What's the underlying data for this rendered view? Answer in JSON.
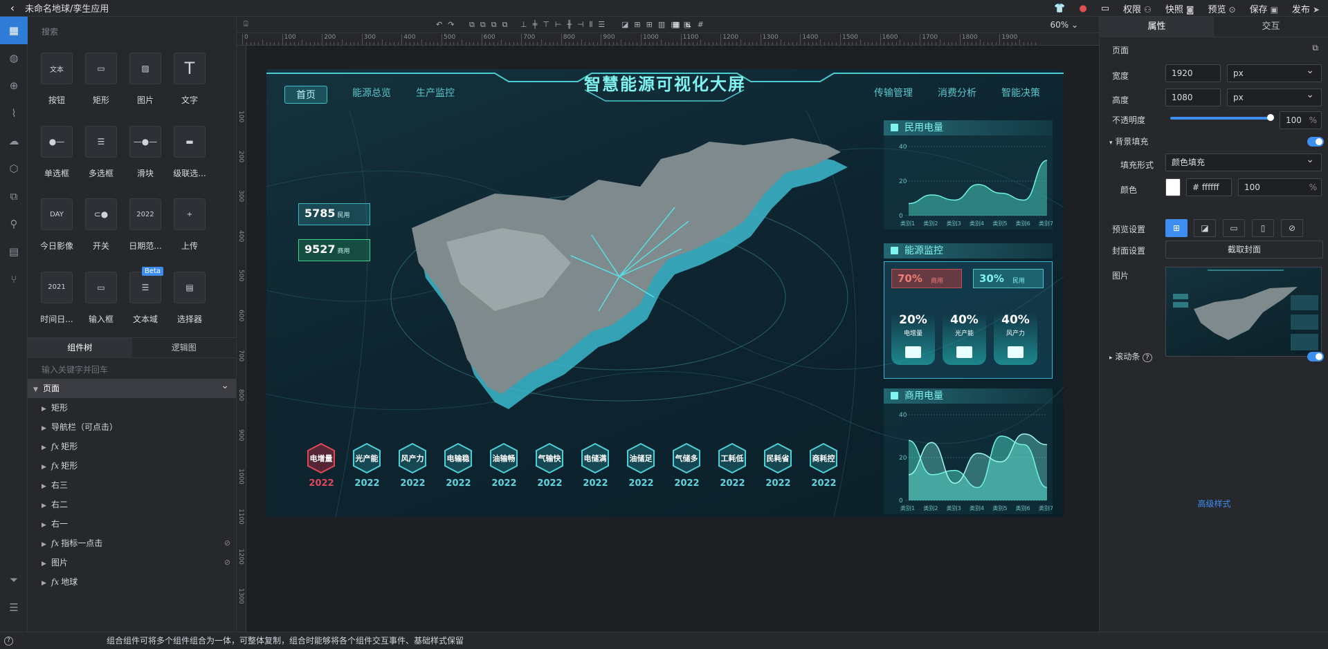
{
  "topbar": {
    "title": "未命名地球/孪生应用",
    "actions": [
      {
        "name": "shirt-icon",
        "label": ""
      },
      {
        "name": "record-icon",
        "label": ""
      },
      {
        "name": "screen-icon",
        "label": ""
      },
      {
        "name": "permission",
        "label": "权限",
        "icon": "users-icon"
      },
      {
        "name": "snapshot",
        "label": "快照",
        "icon": "camera-icon"
      },
      {
        "name": "preview",
        "label": "预览",
        "icon": "play-icon"
      },
      {
        "name": "save",
        "label": "保存",
        "icon": "save-icon"
      },
      {
        "name": "publish",
        "label": "发布",
        "icon": "send-icon"
      }
    ]
  },
  "left_panel": {
    "search_placeholder": "搜索",
    "components": [
      {
        "name": "button",
        "label": "按钮",
        "icon_text": "文本"
      },
      {
        "name": "rect",
        "label": "矩形",
        "icon_text": ""
      },
      {
        "name": "image",
        "label": "图片",
        "icon_text": ""
      },
      {
        "name": "text",
        "label": "文字",
        "icon_text": "T"
      },
      {
        "name": "radio",
        "label": "单选框",
        "icon_text": ""
      },
      {
        "name": "checkbox",
        "label": "多选框",
        "icon_text": ""
      },
      {
        "name": "slider",
        "label": "滑块",
        "icon_text": ""
      },
      {
        "name": "cascader",
        "label": "级联选...",
        "icon_text": ""
      },
      {
        "name": "today-image",
        "label": "今日影像",
        "icon_text": "DAY"
      },
      {
        "name": "switch",
        "label": "开关",
        "icon_text": ""
      },
      {
        "name": "date-range",
        "label": "日期范...",
        "icon_text": "2022"
      },
      {
        "name": "upload",
        "label": "上传",
        "icon_text": "+"
      },
      {
        "name": "datetime",
        "label": "时间日...",
        "icon_text": "2021"
      },
      {
        "name": "input",
        "label": "输入框",
        "icon_text": ""
      },
      {
        "name": "textarea",
        "label": "文本域",
        "icon_text": "",
        "beta": "Beta"
      },
      {
        "name": "selector",
        "label": "选择器",
        "icon_text": ""
      }
    ],
    "tabs": [
      "组件树",
      "逻辑图"
    ],
    "tree_search_placeholder": "输入关键字并回车",
    "tree": [
      {
        "label": "页面",
        "fx": false,
        "root": true
      },
      {
        "label": "矩形",
        "fx": false
      },
      {
        "label": "导航栏（可点击）",
        "fx": false
      },
      {
        "label": "矩形",
        "fx": true
      },
      {
        "label": "矩形",
        "fx": true
      },
      {
        "label": "右三",
        "fx": false
      },
      {
        "label": "右二",
        "fx": false
      },
      {
        "label": "右一",
        "fx": false
      },
      {
        "label": "指标一点击",
        "fx": true,
        "hidden": true
      },
      {
        "label": "图片",
        "fx": false,
        "hidden": true
      },
      {
        "label": "地球",
        "fx": true
      }
    ],
    "beta_badge": "Beta"
  },
  "canvas": {
    "zoom": "60%",
    "ruler_ticks": [
      "0",
      "100",
      "200",
      "300",
      "400",
      "500",
      "600",
      "700",
      "800",
      "900",
      "1000",
      "1100",
      "1200",
      "1300",
      "1400",
      "1500",
      "1600",
      "1700",
      "1800",
      "1900"
    ],
    "vruler_ticks": [
      "100",
      "200",
      "300",
      "400",
      "500",
      "600",
      "700",
      "800",
      "900",
      "1000",
      "1100",
      "1200",
      "1300"
    ]
  },
  "board": {
    "title": "智慧能源可视化大屏",
    "nav_left": [
      "首页",
      "能源总览",
      "生产监控"
    ],
    "nav_right": [
      "传输管理",
      "消费分析",
      "智能决策"
    ],
    "stats": [
      {
        "value": "5785",
        "unit": "民用"
      },
      {
        "value": "9527",
        "unit": "商用"
      }
    ],
    "hexes": [
      {
        "label": "电增量",
        "year": "2022",
        "red": true
      },
      {
        "label": "光产能",
        "year": "2022"
      },
      {
        "label": "风产力",
        "year": "2022"
      },
      {
        "label": "电输稳",
        "year": "2022"
      },
      {
        "label": "油输畅",
        "year": "2022"
      },
      {
        "label": "气输快",
        "year": "2022"
      },
      {
        "label": "电储满",
        "year": "2022"
      },
      {
        "label": "油储足",
        "year": "2022"
      },
      {
        "label": "气储多",
        "year": "2022"
      },
      {
        "label": "工耗低",
        "year": "2022"
      },
      {
        "label": "民耗省",
        "year": "2022"
      },
      {
        "label": "商耗控",
        "year": "2022"
      }
    ],
    "panel1_title": "民用电量",
    "panel2_title": "能源监控",
    "panel3_title": "商用电量",
    "monitor": {
      "badges": [
        {
          "value": "70%",
          "unit": "商用"
        },
        {
          "value": "30%",
          "unit": "民用"
        }
      ],
      "tiles": [
        {
          "value": "20%",
          "label": "电增量"
        },
        {
          "value": "40%",
          "label": "光产能"
        },
        {
          "value": "40%",
          "label": "风产力"
        }
      ]
    }
  },
  "chart_data": [
    {
      "type": "area",
      "title": "民用电量",
      "categories": [
        "类别1",
        "类别2",
        "类别3",
        "类别4",
        "类别5",
        "类别6",
        "类别7"
      ],
      "yticks": [
        "0",
        "20",
        "40"
      ],
      "ylim": [
        0,
        40
      ],
      "series": [
        {
          "values": [
            7,
            12,
            9,
            18,
            13,
            9,
            32
          ]
        }
      ]
    },
    {
      "type": "area",
      "title": "商用电量",
      "categories": [
        "类别1",
        "类别2",
        "类别3",
        "类别4",
        "类别5",
        "类别6",
        "类别7"
      ],
      "yticks": [
        "0",
        "20",
        "40"
      ],
      "ylim": [
        0,
        40
      ],
      "series": [
        {
          "values": [
            28,
            12,
            14,
            6,
            30,
            26,
            6
          ]
        },
        {
          "values": [
            12,
            27,
            8,
            22,
            18,
            31,
            26
          ]
        }
      ]
    }
  ],
  "right_panel": {
    "tabs": [
      "属性",
      "交互"
    ],
    "section": "页面",
    "width_label": "宽度",
    "width_value": "1920",
    "width_unit": "px",
    "height_label": "高度",
    "height_value": "1080",
    "height_unit": "px",
    "opacity_label": "不透明度",
    "opacity_value": "100",
    "opacity_unit": "%",
    "opacity_fraction": 1.0,
    "bg_fill_label": "背景填充",
    "fill_mode_label": "填充形式",
    "fill_mode_value": "颜色填充",
    "color_label": "颜色",
    "color_value": "# ffffff",
    "color_alpha": "100",
    "color_alpha_unit": "%",
    "preview_label": "预览设置",
    "cover_label": "封面设置",
    "cover_button": "截取封面",
    "image_label": "图片",
    "scrollbar_label": "滚动条",
    "advanced": "高级样式"
  },
  "status": {
    "message": "组合组件可将多个组件组合为一体，可整体复制，组合时能够将各个组件交互事件、基础样式保留"
  },
  "colors": {
    "accent": "#3d8ef0",
    "board_cyan": "#7ff3f0",
    "warn": "#e0485a"
  }
}
